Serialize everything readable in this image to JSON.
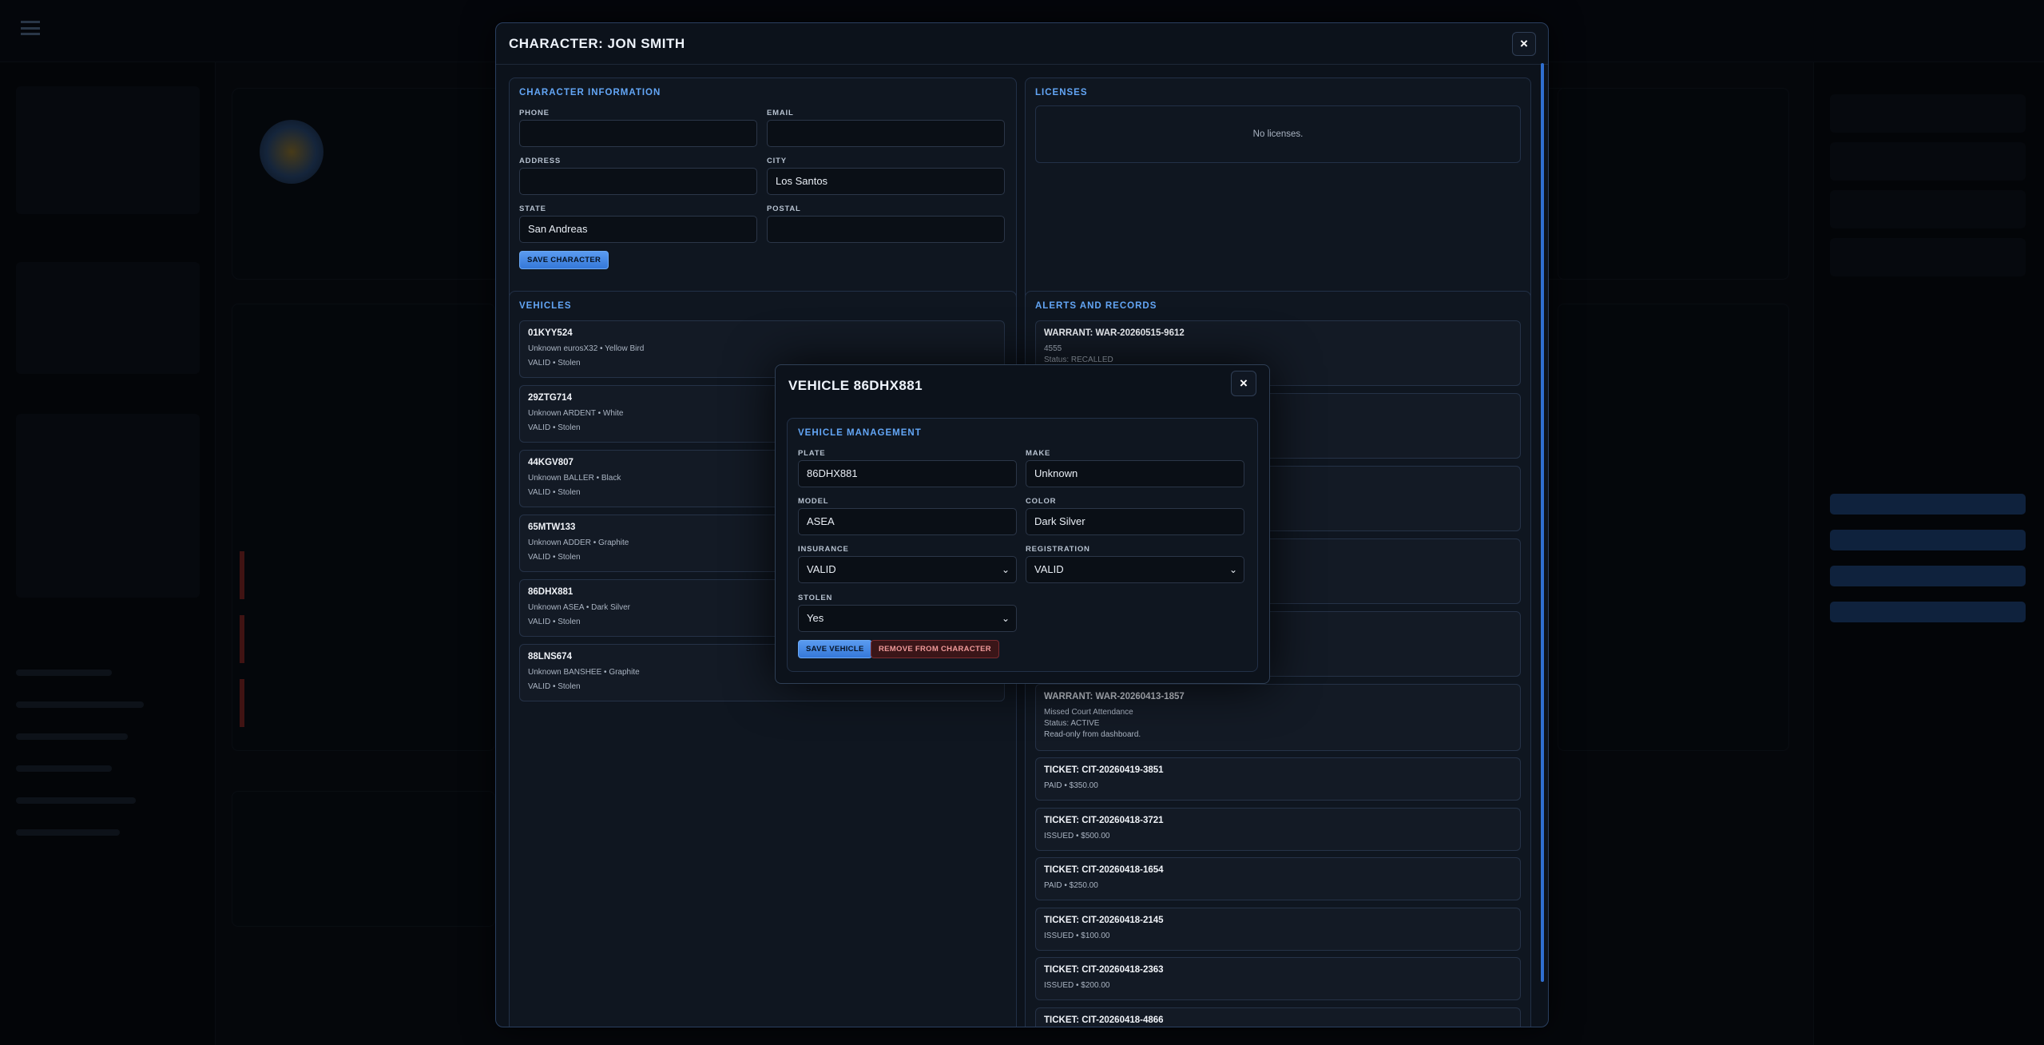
{
  "character_modal": {
    "title": "CHARACTER: JON SMITH",
    "close_label": "×",
    "info": {
      "section_title": "CHARACTER INFORMATION",
      "phone_label": "PHONE",
      "phone_value": "",
      "email_label": "EMAIL",
      "email_value": "",
      "address_label": "ADDRESS",
      "address_value": "",
      "city_label": "CITY",
      "city_value": "Los Santos",
      "state_label": "STATE",
      "state_value": "San Andreas",
      "postal_label": "POSTAL",
      "postal_value": "",
      "save_label": "SAVE CHARACTER"
    },
    "licenses": {
      "section_title": "LICENSES",
      "empty_text": "No licenses."
    },
    "vehicles": {
      "section_title": "VEHICLES",
      "items": [
        {
          "plate": "01KYY524",
          "desc": "Unknown eurosX32 • Yellow Bird",
          "status": "VALID • Stolen"
        },
        {
          "plate": "29ZTG714",
          "desc": "Unknown ARDENT • White",
          "status": "VALID • Stolen"
        },
        {
          "plate": "44KGV807",
          "desc": "Unknown BALLER • Black",
          "status": "VALID • Stolen"
        },
        {
          "plate": "65MTW133",
          "desc": "Unknown ADDER • Graphite",
          "status": "VALID • Stolen"
        },
        {
          "plate": "86DHX881",
          "desc": "Unknown ASEA • Dark Silver",
          "status": "VALID • Stolen"
        },
        {
          "plate": "88LNS674",
          "desc": "Unknown BANSHEE • Graphite",
          "status": "VALID • Stolen"
        }
      ]
    },
    "alerts": {
      "section_title": "ALERTS AND RECORDS",
      "warrant_first": {
        "title": "WARRANT: WAR-20260515-9612",
        "line1": "4555",
        "line2": "Status: RECALLED"
      },
      "warrant_last": {
        "title": "WARRANT: WAR-20260413-1857",
        "line1": "Missed Court Attendance",
        "line2": "Status: ACTIVE",
        "line3": "Read-only from dashboard."
      },
      "tickets": [
        {
          "title": "TICKET: CIT-20260419-3851",
          "sub": "PAID • $350.00"
        },
        {
          "title": "TICKET: CIT-20260418-3721",
          "sub": "ISSUED • $500.00"
        },
        {
          "title": "TICKET: CIT-20260418-1654",
          "sub": "PAID • $250.00"
        },
        {
          "title": "TICKET: CIT-20260418-2145",
          "sub": "ISSUED • $100.00"
        },
        {
          "title": "TICKET: CIT-20260418-2363",
          "sub": "ISSUED • $200.00"
        },
        {
          "title": "TICKET: CIT-20260418-4866",
          "sub": ""
        }
      ]
    }
  },
  "vehicle_modal": {
    "title": "VEHICLE 86DHX881",
    "close_label": "×",
    "section_title": "VEHICLE MANAGEMENT",
    "plate_label": "PLATE",
    "plate_value": "86DHX881",
    "make_label": "MAKE",
    "make_value": "Unknown",
    "model_label": "MODEL",
    "model_value": "ASEA",
    "color_label": "COLOR",
    "color_value": "Dark Silver",
    "insurance_label": "INSURANCE",
    "insurance_value": "VALID",
    "registration_label": "REGISTRATION",
    "registration_value": "VALID",
    "stolen_label": "STOLEN",
    "stolen_value": "Yes",
    "save_label": "SAVE VEHICLE",
    "remove_label": "REMOVE FROM CHARACTER"
  },
  "colors": {
    "accent": "#63a6f6",
    "button_blue": "#3578d8",
    "danger": "#7b2b30",
    "modal_bg": "#0c121b"
  },
  "icons": {
    "close": "close-icon",
    "dropdown": "chevron-down-icon"
  }
}
